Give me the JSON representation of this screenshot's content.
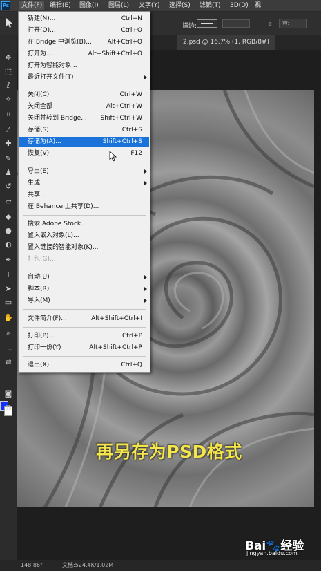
{
  "menubar": {
    "logo": "Ps",
    "items": [
      "文件(F)",
      "编辑(E)",
      "图像(I)",
      "图层(L)",
      "文字(Y)",
      "选择(S)",
      "滤镜(T)",
      "3D(D)",
      "视"
    ]
  },
  "options": {
    "feather_label": "描边:",
    "width_label": "W:"
  },
  "document": {
    "tab_title": "2.psd @ 16.7% (1, RGB/8#)"
  },
  "file_menu": {
    "items": [
      {
        "label": "新建(N)...",
        "shortcut": "Ctrl+N"
      },
      {
        "label": "打开(O)...",
        "shortcut": "Ctrl+O"
      },
      {
        "label": "在 Bridge 中浏览(B)...",
        "shortcut": "Alt+Ctrl+O"
      },
      {
        "label": "打开为...",
        "shortcut": "Alt+Shift+Ctrl+O"
      },
      {
        "label": "打开为智能对象...",
        "shortcut": ""
      },
      {
        "label": "最近打开文件(T)",
        "shortcut": ""
      },
      {
        "label": "关闭(C)",
        "shortcut": "Ctrl+W"
      },
      {
        "label": "关闭全部",
        "shortcut": "Alt+Ctrl+W"
      },
      {
        "label": "关闭并转到 Bridge...",
        "shortcut": "Shift+Ctrl+W"
      },
      {
        "label": "存储(S)",
        "shortcut": "Ctrl+S"
      },
      {
        "label": "存储为(A)...",
        "shortcut": "Shift+Ctrl+S"
      },
      {
        "label": "恢复(V)",
        "shortcut": "F12"
      },
      {
        "label": "导出(E)",
        "shortcut": ""
      },
      {
        "label": "生成",
        "shortcut": ""
      },
      {
        "label": "共享...",
        "shortcut": ""
      },
      {
        "label": "在 Behance 上共享(D)...",
        "shortcut": ""
      },
      {
        "label": "搜索 Adobe Stock...",
        "shortcut": ""
      },
      {
        "label": "置入嵌入对象(L)...",
        "shortcut": ""
      },
      {
        "label": "置入链接的智能对象(K)...",
        "shortcut": ""
      },
      {
        "label": "打包(G)...",
        "shortcut": ""
      },
      {
        "label": "自动(U)",
        "shortcut": ""
      },
      {
        "label": "脚本(R)",
        "shortcut": ""
      },
      {
        "label": "导入(M)",
        "shortcut": ""
      },
      {
        "label": "文件简介(F)...",
        "shortcut": "Alt+Shift+Ctrl+I"
      },
      {
        "label": "打印(P)...",
        "shortcut": "Ctrl+P"
      },
      {
        "label": "打印一份(Y)",
        "shortcut": "Alt+Shift+Ctrl+P"
      },
      {
        "label": "退出(X)",
        "shortcut": "Ctrl+Q"
      }
    ]
  },
  "caption": "再另存为PSD格式",
  "status": {
    "zoom": "148.86°",
    "doc": "文档:524.4K/1.02M"
  },
  "watermark": {
    "logo": "Bai🐾经验",
    "url": "jingyan.baidu.com"
  },
  "colors": {
    "foreground": "#1230ff",
    "background": "#ffffff",
    "highlight": "#1a73d8",
    "caption": "#f4e64a"
  }
}
